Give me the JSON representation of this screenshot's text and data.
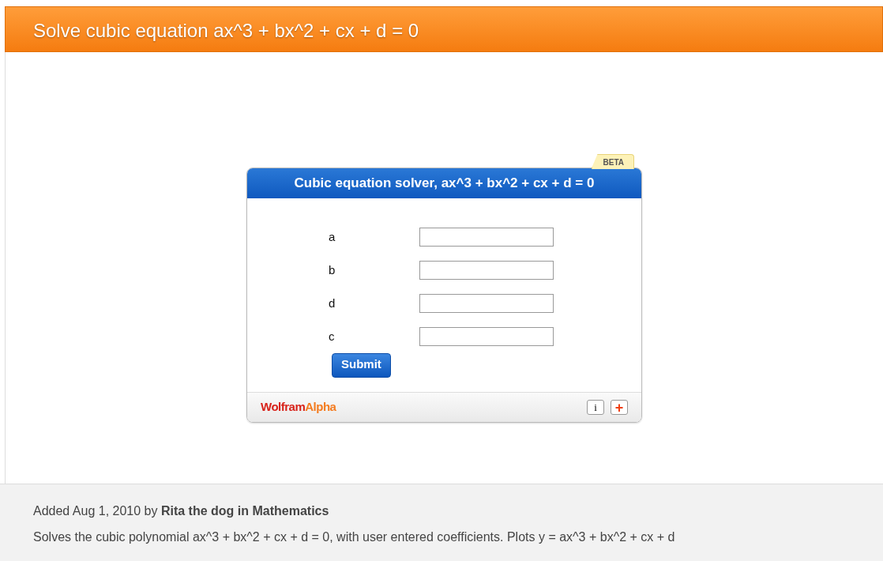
{
  "page_title": "Solve cubic equation ax^3 + bx^2 + cx + d = 0",
  "widget": {
    "badge": "BETA",
    "title": "Cubic equation solver, ax^3 + bx^2 + cx + d = 0",
    "fields": [
      {
        "label": "a"
      },
      {
        "label": "b"
      },
      {
        "label": "d"
      },
      {
        "label": "c"
      }
    ],
    "submit": "Submit",
    "logo": [
      "Wolfram",
      "Alpha"
    ],
    "info_button": "i",
    "add_button": "+"
  },
  "footer": {
    "meta": "Added Aug 1, 2010 by **Rita the dog in Mathematics**",
    "description": "Solves the cubic polynomial ax^3 + bx^2 + cx + d = 0, with user entered coefficients. Plots y = ax^3 + bx^2 + cx + d"
  }
}
